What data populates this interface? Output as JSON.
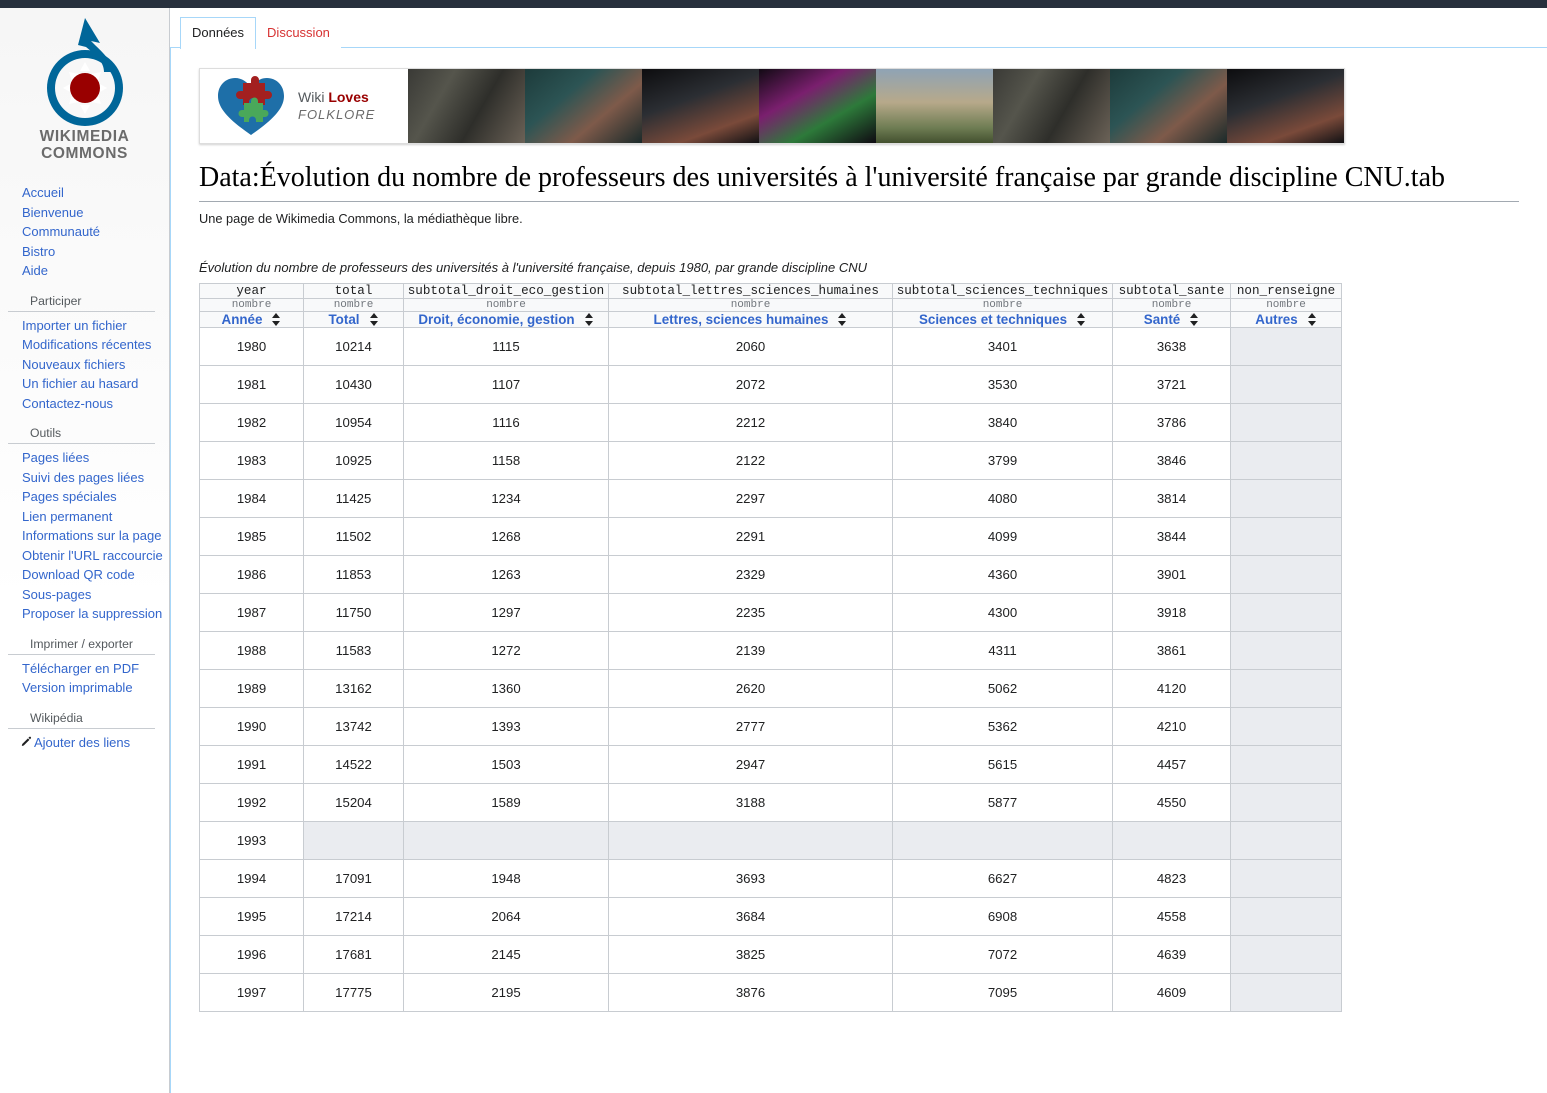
{
  "sidebar": {
    "logo": {
      "line1": "WIKIMEDIA",
      "line2": "COMMONS"
    },
    "groups": [
      {
        "heading": "",
        "items": [
          {
            "label": "Accueil"
          },
          {
            "label": "Bienvenue"
          },
          {
            "label": "Communauté"
          },
          {
            "label": "Bistro"
          },
          {
            "label": "Aide"
          }
        ]
      },
      {
        "heading": "Participer",
        "items": [
          {
            "label": "Importer un fichier"
          },
          {
            "label": "Modifications récentes"
          },
          {
            "label": "Nouveaux fichiers"
          },
          {
            "label": "Un fichier au hasard"
          },
          {
            "label": "Contactez-nous"
          }
        ]
      },
      {
        "heading": "Outils",
        "items": [
          {
            "label": "Pages liées"
          },
          {
            "label": "Suivi des pages liées"
          },
          {
            "label": "Pages spéciales"
          },
          {
            "label": "Lien permanent"
          },
          {
            "label": "Informations sur la page"
          },
          {
            "label": "Obtenir l'URL raccourcie"
          },
          {
            "label": "Download QR code"
          },
          {
            "label": "Sous-pages"
          },
          {
            "label": "Proposer la suppression"
          }
        ]
      },
      {
        "heading": "Imprimer / exporter",
        "items": [
          {
            "label": "Télécharger en PDF"
          },
          {
            "label": "Version imprimable"
          }
        ]
      },
      {
        "heading": "Wikipédia",
        "items": []
      }
    ],
    "add_links_label": "Ajouter des liens"
  },
  "tabs": [
    {
      "label": "Données",
      "state": "selected"
    },
    {
      "label": "Discussion",
      "state": "new"
    }
  ],
  "banner": {
    "title_prefix": "Wiki ",
    "title_strong": "Loves",
    "subtitle": "FOLKLORE"
  },
  "page": {
    "title": "Data:Évolution du nombre de professeurs des universités à l'université française par grande discipline CNU.tab",
    "site_sub": "Une page de Wikimedia Commons, la médiathèque libre.",
    "table_description": "Évolution du nombre de professeurs des universités à l'université française, depuis 1980, par grande discipline CNU"
  },
  "chart_data": {
    "type": "table",
    "title": "Évolution du nombre de professeurs des universités à l'université française, depuis 1980, par grande discipline CNU",
    "field_names": [
      "year",
      "total",
      "subtotal_droit_eco_gestion",
      "subtotal_lettres_sciences_humaines",
      "subtotal_sciences_techniques",
      "subtotal_sante",
      "non_renseigne"
    ],
    "field_types": [
      "nombre",
      "nombre",
      "nombre",
      "nombre",
      "nombre",
      "nombre",
      "nombre"
    ],
    "categories": [
      "Année",
      "Total",
      "Droit, économie, gestion",
      "Lettres, sciences humaines",
      "Sciences et techniques",
      "Santé",
      "Autres"
    ],
    "rows": [
      [
        "1980",
        "10214",
        "1115",
        "2060",
        "3401",
        "3638",
        ""
      ],
      [
        "1981",
        "10430",
        "1107",
        "2072",
        "3530",
        "3721",
        ""
      ],
      [
        "1982",
        "10954",
        "1116",
        "2212",
        "3840",
        "3786",
        ""
      ],
      [
        "1983",
        "10925",
        "1158",
        "2122",
        "3799",
        "3846",
        ""
      ],
      [
        "1984",
        "11425",
        "1234",
        "2297",
        "4080",
        "3814",
        ""
      ],
      [
        "1985",
        "11502",
        "1268",
        "2291",
        "4099",
        "3844",
        ""
      ],
      [
        "1986",
        "11853",
        "1263",
        "2329",
        "4360",
        "3901",
        ""
      ],
      [
        "1987",
        "11750",
        "1297",
        "2235",
        "4300",
        "3918",
        ""
      ],
      [
        "1988",
        "11583",
        "1272",
        "2139",
        "4311",
        "3861",
        ""
      ],
      [
        "1989",
        "13162",
        "1360",
        "2620",
        "5062",
        "4120",
        ""
      ],
      [
        "1990",
        "13742",
        "1393",
        "2777",
        "5362",
        "4210",
        ""
      ],
      [
        "1991",
        "14522",
        "1503",
        "2947",
        "5615",
        "4457",
        ""
      ],
      [
        "1992",
        "15204",
        "1589",
        "3188",
        "5877",
        "4550",
        ""
      ],
      [
        "1993",
        "",
        "",
        "",
        "",
        "",
        ""
      ],
      [
        "1994",
        "17091",
        "1948",
        "3693",
        "6627",
        "4823",
        ""
      ],
      [
        "1995",
        "17214",
        "2064",
        "3684",
        "6908",
        "4558",
        ""
      ],
      [
        "1996",
        "17681",
        "2145",
        "3825",
        "7072",
        "4639",
        ""
      ],
      [
        "1997",
        "17775",
        "2195",
        "3876",
        "7095",
        "4609",
        ""
      ]
    ]
  },
  "colors": {
    "link": "#3366cc",
    "new_link": "#d73333",
    "topbar": "#27303d",
    "table_border": "#c8ccd1",
    "empty_cell": "#eaecf0"
  }
}
